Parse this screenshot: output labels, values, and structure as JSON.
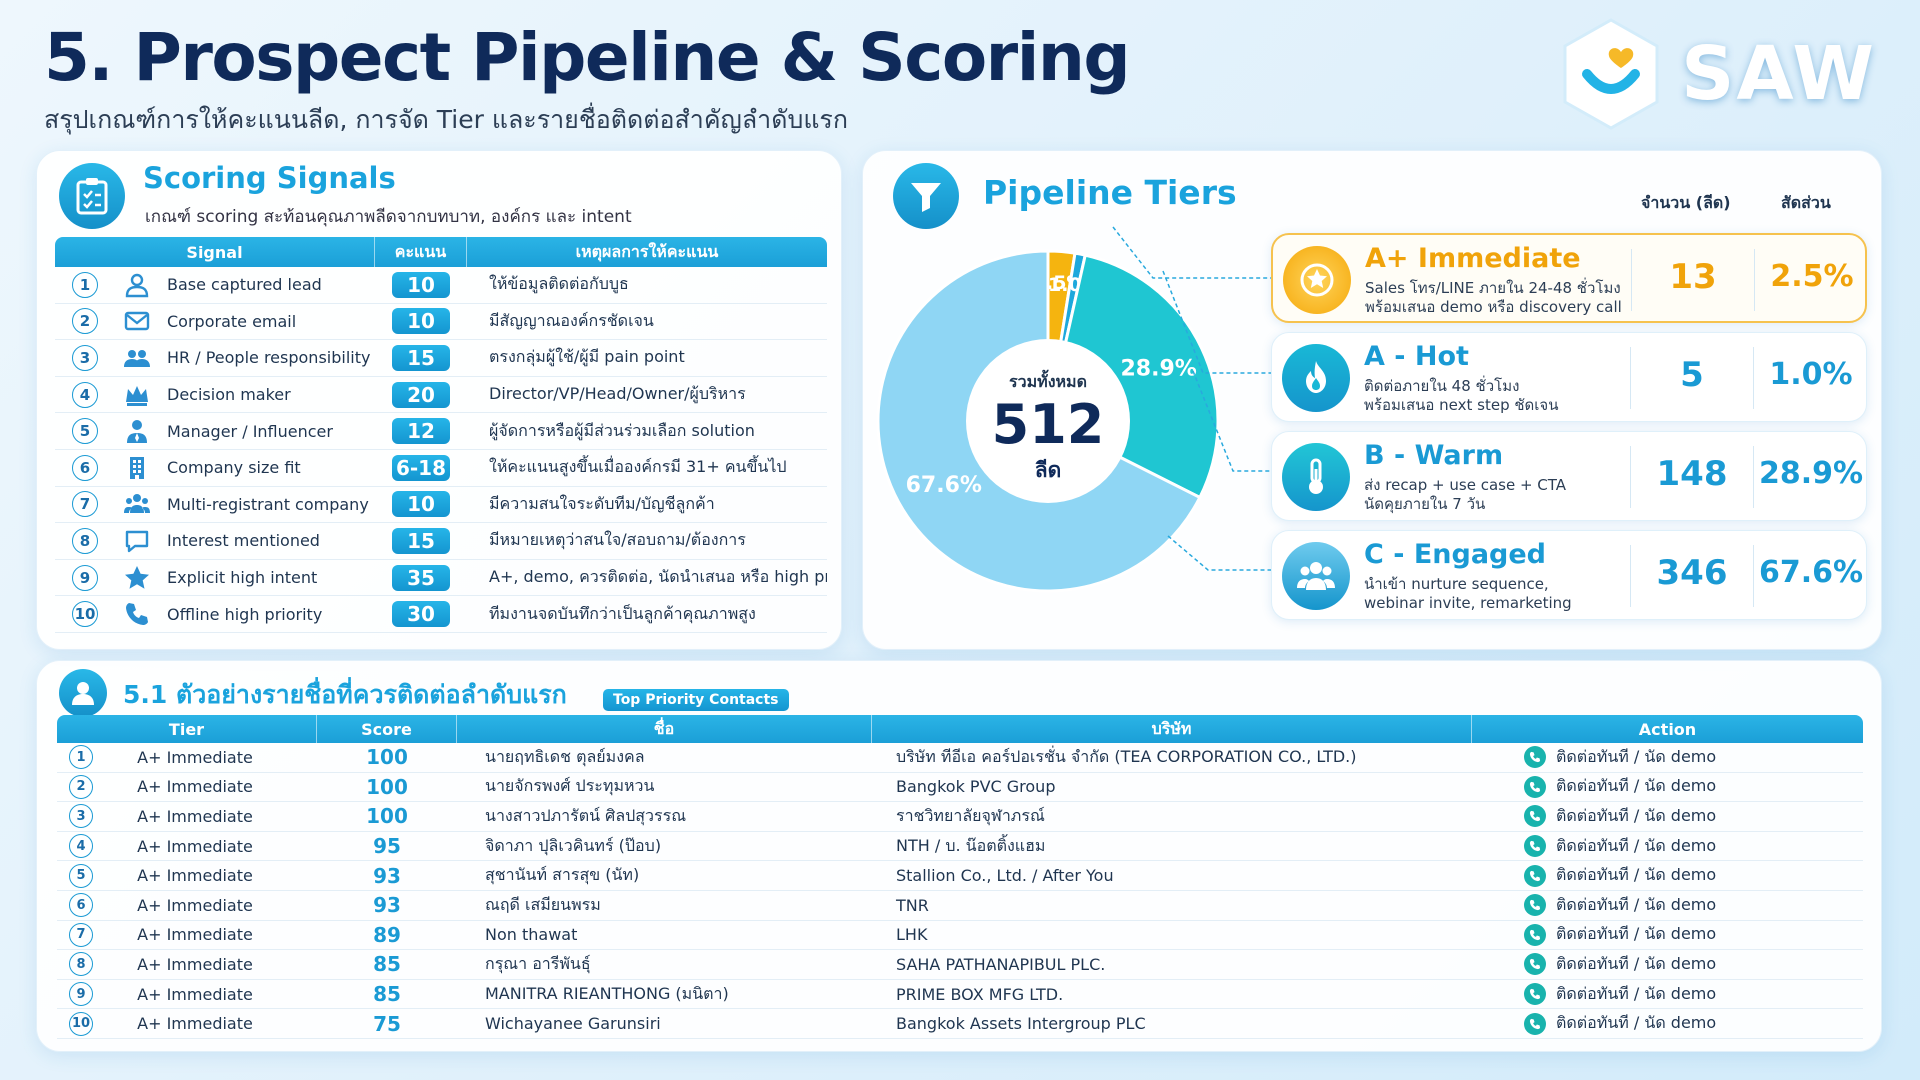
{
  "header": {
    "title": "5. Prospect Pipeline & Scoring",
    "subtitle": "สรุปเกณฑ์การให้คะแนนลีด, การจัด Tier และรายชื่อติดต่อสำคัญลำดับแรก",
    "logo_text": "SAW"
  },
  "signals": {
    "title": "Scoring Signals",
    "subtitle": "เกณฑ์ scoring สะท้อนคุณภาพลีดจากบทบาท, องค์กร และ intent",
    "columns": [
      "Signal",
      "คะแนน",
      "เหตุผลการให้คะแนน"
    ],
    "rows": [
      {
        "no": "1",
        "icon": "person-icon",
        "signal": "Base captured lead",
        "score": "10",
        "reason": "ให้ข้อมูลติดต่อกับบูธ"
      },
      {
        "no": "2",
        "icon": "mail-icon",
        "signal": "Corporate email",
        "score": "10",
        "reason": "มีสัญญาณองค์กรชัดเจน"
      },
      {
        "no": "3",
        "icon": "people-icon",
        "signal": "HR / People responsibility",
        "score": "15",
        "reason": "ตรงกลุ่มผู้ใช้/ผู้มี pain point"
      },
      {
        "no": "4",
        "icon": "crown-icon",
        "signal": "Decision maker",
        "score": "20",
        "reason": "Director/VP/Head/Owner/ผู้บริหาร"
      },
      {
        "no": "5",
        "icon": "user-tie-icon",
        "signal": "Manager / Influencer",
        "score": "12",
        "reason": "ผู้จัดการหรือผู้มีส่วนร่วมเลือก solution"
      },
      {
        "no": "6",
        "icon": "building-icon",
        "signal": "Company size fit",
        "score": "6-18",
        "reason": "ให้คะแนนสูงขึ้นเมื่อองค์กรมี 31+ คนขึ้นไป"
      },
      {
        "no": "7",
        "icon": "group-icon",
        "signal": "Multi-registrant company",
        "score": "10",
        "reason": "มีความสนใจระดับทีม/บัญชีลูกค้า"
      },
      {
        "no": "8",
        "icon": "chat-icon",
        "signal": "Interest mentioned",
        "score": "15",
        "reason": "มีหมายเหตุว่าสนใจ/สอบถาม/ต้องการ"
      },
      {
        "no": "9",
        "icon": "star-icon",
        "signal": "Explicit high intent",
        "score": "35",
        "reason": "A+, demo, ควรติดต่อ, นัดนำเสนอ หรือ high priority"
      },
      {
        "no": "10",
        "icon": "phone-icon",
        "signal": "Offline high priority",
        "score": "30",
        "reason": "ทีมงานจดบันทึกว่าเป็นลูกค้าคุณภาพสูง"
      }
    ]
  },
  "pipeline": {
    "title": "Pipeline Tiers",
    "col_count": "จำนวน (ลีด)",
    "col_share": "สัดส่วน",
    "total_label": "รวมทั้งหมด",
    "total_value": "512",
    "total_unit": "ลีด",
    "tiers": [
      {
        "name": "A+ Immediate",
        "desc1": "Sales โทร/LINE ภายใน 24-48 ชั่วโมง",
        "desc2": "พร้อมเสนอ demo หรือ discovery call",
        "count": "13",
        "share": "2.5%",
        "icon": "star-badge-icon",
        "color": "#f5b40f",
        "name_color": "#f0a30a"
      },
      {
        "name": "A - Hot",
        "desc1": "ติดต่อภายใน 48 ชั่วโมง",
        "desc2": "พร้อมเสนอ next step ชัดเจน",
        "count": "5",
        "share": "1.0%",
        "icon": "flame-icon",
        "color": "#19b8d6",
        "name_color": "#1a9ad4"
      },
      {
        "name": "B - Warm",
        "desc1": "ส่ง recap + use case + CTA",
        "desc2": "นัดคุยภายใน 7 วัน",
        "count": "148",
        "share": "28.9%",
        "icon": "thermometer-icon",
        "color": "#22c6d6",
        "name_color": "#1a9ad4"
      },
      {
        "name": "C - Engaged",
        "desc1": "นำเข้า nurture sequence,",
        "desc2": "webinar invite, remarketing",
        "count": "346",
        "share": "67.6%",
        "icon": "group-icon",
        "color": "#6fcbee",
        "name_color": "#1a9ad4"
      }
    ]
  },
  "chart_data": {
    "type": "pie",
    "categories": [
      "A+ Immediate",
      "A - Hot",
      "B - Warm",
      "C - Engaged"
    ],
    "values": [
      13,
      5,
      148,
      346
    ],
    "labels": [
      "2.5%",
      "1.0%",
      "28.9%",
      "67.6%"
    ],
    "colors": [
      "#f5b40f",
      "#1ea8dc",
      "#1fc6d2",
      "#8fd6f4"
    ],
    "title": "Pipeline Tiers"
  },
  "contacts": {
    "title": "5.1 ตัวอย่างรายชื่อที่ควรติดต่อลำดับแรก",
    "badge": "Top Priority Contacts",
    "columns": [
      "Tier",
      "Score",
      "ชื่อ",
      "บริษัท",
      "Action"
    ],
    "rows": [
      {
        "no": "1",
        "tier": "A+ Immediate",
        "score": "100",
        "name": "นายฤทธิเดช ตุลย์มงคล",
        "company": "บริษัท ทีอีเอ คอร์ปอเรชั่น จำกัด (TEA CORPORATION CO., LTD.)",
        "action": "ติดต่อทันที / นัด demo"
      },
      {
        "no": "2",
        "tier": "A+ Immediate",
        "score": "100",
        "name": "นายจักรพงศ์ ประทุมหวน",
        "company": "Bangkok PVC Group",
        "action": "ติดต่อทันที / นัด demo"
      },
      {
        "no": "3",
        "tier": "A+ Immediate",
        "score": "100",
        "name": "นางสาวปภารัตน์ ศิลปสุวรรณ",
        "company": "ราชวิทยาลัยจุฬาภรณ์",
        "action": "ติดต่อทันที / นัด demo"
      },
      {
        "no": "4",
        "tier": "A+ Immediate",
        "score": "95",
        "name": "จิดาภา ปุลิเวคินทร์ (ป๊อบ)",
        "company": "NTH / บ. น๊อตติ้งแฮม",
        "action": "ติดต่อทันที / นัด demo"
      },
      {
        "no": "5",
        "tier": "A+ Immediate",
        "score": "93",
        "name": "สุชานันท์ สารสุข (นัท)",
        "company": "Stallion Co., Ltd. / After You",
        "action": "ติดต่อทันที / นัด demo"
      },
      {
        "no": "6",
        "tier": "A+ Immediate",
        "score": "93",
        "name": "ณฤดี เสมียนพรม",
        "company": "TNR",
        "action": "ติดต่อทันที / นัด demo"
      },
      {
        "no": "7",
        "tier": "A+ Immediate",
        "score": "89",
        "name": "Non thawat",
        "company": "LHK",
        "action": "ติดต่อทันที / นัด demo"
      },
      {
        "no": "8",
        "tier": "A+ Immediate",
        "score": "85",
        "name": "กรุณา อารีพันธุ์",
        "company": "SAHA PATHANAPIBUL PLC.",
        "action": "ติดต่อทันที / นัด demo"
      },
      {
        "no": "9",
        "tier": "A+ Immediate",
        "score": "85",
        "name": "MANITRA RIEANTHONG (มนิตา)",
        "company": "PRIME BOX MFG LTD.",
        "action": "ติดต่อทันที / นัด demo"
      },
      {
        "no": "10",
        "tier": "A+ Immediate",
        "score": "75",
        "name": "Wichayanee Garunsiri",
        "company": "Bangkok Assets Intergroup PLC",
        "action": "ติดต่อทันที / นัด demo"
      }
    ]
  }
}
